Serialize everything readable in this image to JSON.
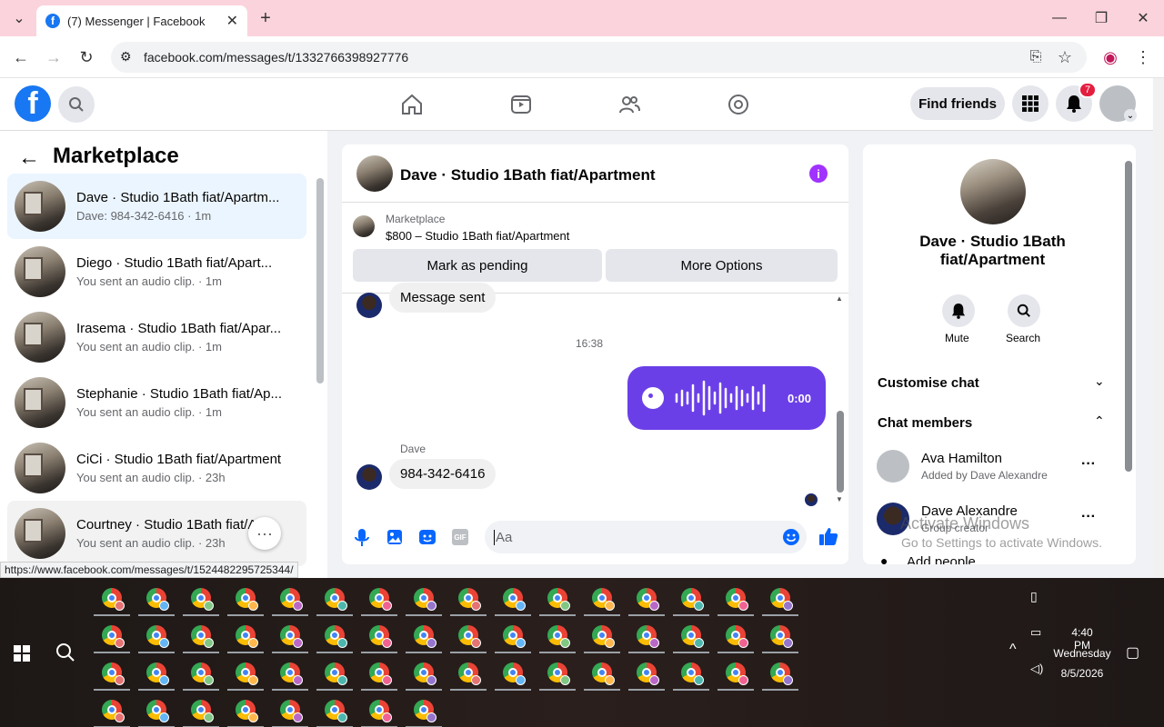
{
  "browser": {
    "tab_title": "(7) Messenger | Facebook",
    "url": "facebook.com/messages/t/1332766398927776",
    "status_url": "https://www.facebook.com/messages/t/1524482295725344/"
  },
  "fb_header": {
    "find_friends_label": "Find friends",
    "notification_count": "7"
  },
  "left_panel": {
    "title": "Marketplace",
    "conversations": [
      {
        "name": "Dave · Studio 1Bath fiat/Apartm...",
        "preview": "Dave: 984-342-6416 · 1m"
      },
      {
        "name": "Diego · Studio 1Bath fiat/Apart...",
        "preview": "You sent an audio clip. · 1m"
      },
      {
        "name": "Irasema · Studio 1Bath fiat/Apar...",
        "preview": "You sent an audio clip. · 1m"
      },
      {
        "name": "Stephanie · Studio 1Bath fiat/Ap...",
        "preview": "You sent an audio clip. · 1m"
      },
      {
        "name": "CiCi · Studio 1Bath fiat/Apartment",
        "preview": "You sent an audio clip. · 23h"
      },
      {
        "name": "Courtney · Studio 1Bath fiat/A...",
        "preview": "You sent an audio clip. · 23h"
      }
    ]
  },
  "chat": {
    "title": "Dave · Studio 1Bath fiat/Apartment",
    "marketplace_label": "Marketplace",
    "listing": "$800 – Studio 1Bath fiat/Apartment",
    "mark_pending_label": "Mark as pending",
    "more_options_label": "More Options",
    "message_sent": "Message sent",
    "time_divider": "16:38",
    "audio_duration": "0:00",
    "sender_name": "Dave",
    "incoming_message": "984-342-6416",
    "composer_placeholder": "Aa"
  },
  "right_panel": {
    "name": "Dave · Studio 1Bath fiat/Apartment",
    "mute_label": "Mute",
    "search_label": "Search",
    "customise_label": "Customise chat",
    "members_label": "Chat members",
    "members": [
      {
        "name": "Ava Hamilton",
        "subtitle": "Added by Dave Alexandre"
      },
      {
        "name": "Dave Alexandre",
        "subtitle": "Group creator"
      }
    ],
    "add_people_label": "Add people",
    "watermark_title": "Activate Windows",
    "watermark_sub": "Go to Settings to activate Windows."
  },
  "taskbar": {
    "time": "4:40 PM",
    "day": "Wednesday",
    "date": "8/5/2026"
  }
}
